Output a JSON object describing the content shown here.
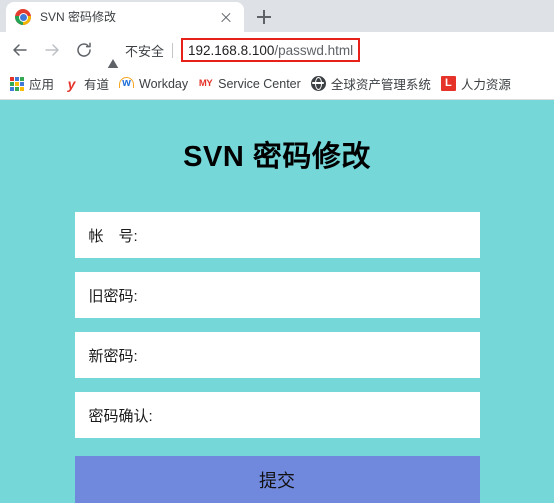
{
  "browser": {
    "tab": {
      "title": "SVN 密码修改",
      "favicon": "chrome-favicon",
      "close_label": "×"
    },
    "new_tab_label": "+",
    "nav": {
      "back": "back-arrow-icon",
      "forward": "forward-arrow-icon",
      "reload": "reload-icon"
    },
    "omnibox": {
      "security_icon": "warning-triangle-icon",
      "security_label": "不安全",
      "url_host": "192.168.8.100",
      "url_path": "/passwd.html",
      "url_full": "192.168.8.100/passwd.html",
      "highlight_color": "#e8201a"
    },
    "bookmarks": [
      {
        "label": "应用",
        "icon": "apps-grid-icon"
      },
      {
        "label": "有道",
        "icon": "youdao-icon",
        "glyph": "y"
      },
      {
        "label": "Workday",
        "icon": "workday-icon",
        "glyph": "w"
      },
      {
        "label": "Service Center",
        "icon": "my-icon",
        "glyph": "MY"
      },
      {
        "label": "全球资产管理系统",
        "icon": "globe-icon"
      },
      {
        "label": "人力资源",
        "icon": "hr-icon",
        "glyph": "L"
      }
    ]
  },
  "page": {
    "title": "SVN 密码修改",
    "background_color": "#76d7d9",
    "fields": [
      {
        "label": "帐　号:",
        "value": "",
        "placeholder": ""
      },
      {
        "label": "旧密码:",
        "value": "",
        "placeholder": ""
      },
      {
        "label": "新密码:",
        "value": "",
        "placeholder": ""
      },
      {
        "label": "密码确认:",
        "value": "",
        "placeholder": ""
      }
    ],
    "submit": {
      "label": "提交",
      "color": "#7189dd"
    }
  }
}
